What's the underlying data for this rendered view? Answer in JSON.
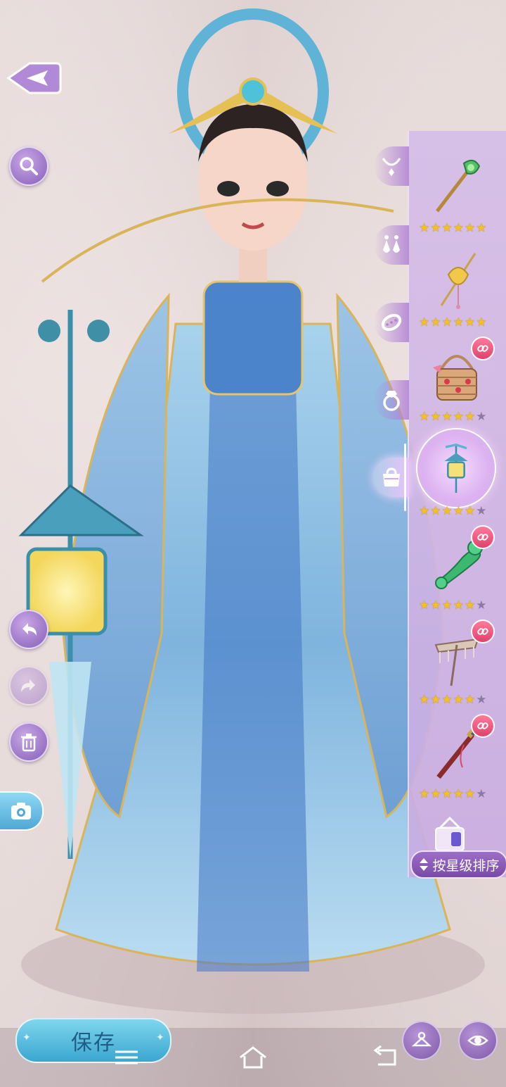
{
  "toolbar": {
    "back_icon": "back-arrow-icon",
    "search_icon": "search-icon",
    "undo_icon": "undo-icon",
    "redo_icon": "redo-icon",
    "delete_icon": "trash-icon",
    "camera_icon": "camera-icon"
  },
  "categories": [
    {
      "name": "necklace",
      "icon": "necklace-icon",
      "active": false
    },
    {
      "name": "earrings",
      "icon": "earrings-icon",
      "active": false
    },
    {
      "name": "bracelet",
      "icon": "bracelet-icon",
      "active": false
    },
    {
      "name": "ring",
      "icon": "ring-icon",
      "active": false
    },
    {
      "name": "handheld",
      "icon": "handbag-icon",
      "active": true
    }
  ],
  "items": [
    {
      "icon": "green-scepter-icon",
      "stars": 6,
      "max_stars": 6,
      "linked": false,
      "selected": false
    },
    {
      "icon": "golden-lotus-staff-icon",
      "stars": 6,
      "max_stars": 6,
      "linked": false,
      "selected": false
    },
    {
      "icon": "cherry-basket-icon",
      "stars": 5,
      "max_stars": 6,
      "linked": true,
      "selected": false
    },
    {
      "icon": "blue-lantern-icon",
      "stars": 5,
      "max_stars": 6,
      "linked": false,
      "selected": true
    },
    {
      "icon": "jade-ruyi-icon",
      "stars": 5,
      "max_stars": 6,
      "linked": true,
      "selected": false
    },
    {
      "icon": "pearl-parasol-icon",
      "stars": 5,
      "max_stars": 6,
      "linked": true,
      "selected": false
    },
    {
      "icon": "red-sword-icon",
      "stars": 5,
      "max_stars": 6,
      "linked": true,
      "selected": false
    }
  ],
  "sort_button": {
    "label": "按星级排序",
    "icon": "sort-arrows-icon"
  },
  "save_button": {
    "label": "保存"
  },
  "bottom_right": {
    "wardrobe_icon": "hanger-icon",
    "eye_icon": "eye-icon"
  },
  "nav": {
    "menu_icon": "menu-icon",
    "home_icon": "home-icon",
    "back_icon": "back-icon"
  },
  "colors": {
    "accent_purple": "#9a74c6",
    "save_blue": "#3aa6cf",
    "star_gold": "#f5c020",
    "link_pink": "#e0426a"
  }
}
